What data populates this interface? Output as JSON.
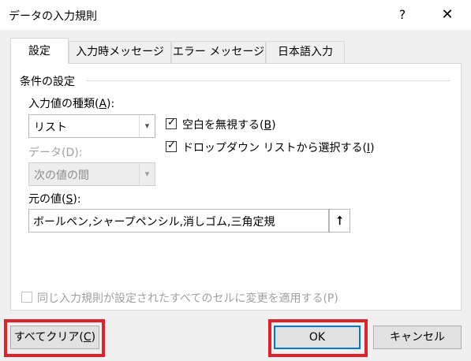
{
  "dialog": {
    "title": "データの入力規則",
    "help": "?",
    "close": "✕"
  },
  "tabs": [
    {
      "label": "設定",
      "active": true
    },
    {
      "label": "入力時メッセージ",
      "active": false
    },
    {
      "label": "エラー メッセージ",
      "active": false
    },
    {
      "label": "日本語入力",
      "active": false
    }
  ],
  "settings": {
    "group_label": "条件の設定",
    "allow_label_prefix": "入力値の種類(",
    "allow_label_key": "A",
    "allow_label_suffix": "):",
    "allow_value": "リスト",
    "data_label": "データ(D):",
    "data_value": "次の値の間",
    "ignore_blank_label_prefix": "空白を無視する(",
    "ignore_blank_key": "B",
    "ignore_blank_suffix": ")",
    "ignore_blank_checked": true,
    "dropdown_label_prefix": "ドロップダウン リストから選択する(",
    "dropdown_key": "I",
    "dropdown_suffix": ")",
    "dropdown_checked": true,
    "source_label_prefix": "元の値(",
    "source_label_key": "S",
    "source_label_suffix": "):",
    "source_value": "ボールペン,シャープペンシル,消しゴム,三角定規",
    "apply_all_label": "同じ入力規則が設定されたすべてのセルに変更を適用する(P)",
    "apply_all_checked": false
  },
  "buttons": {
    "clear_all_prefix": "すべてクリア(",
    "clear_all_key": "C",
    "clear_all_suffix": ")",
    "ok": "OK",
    "cancel": "キャンセル"
  },
  "colors": {
    "highlight": "#e0202a",
    "default_button_border": "#0078d7"
  },
  "icons": {
    "checkmark": "✓",
    "dropdown": "▾",
    "range_select": "⭡"
  }
}
